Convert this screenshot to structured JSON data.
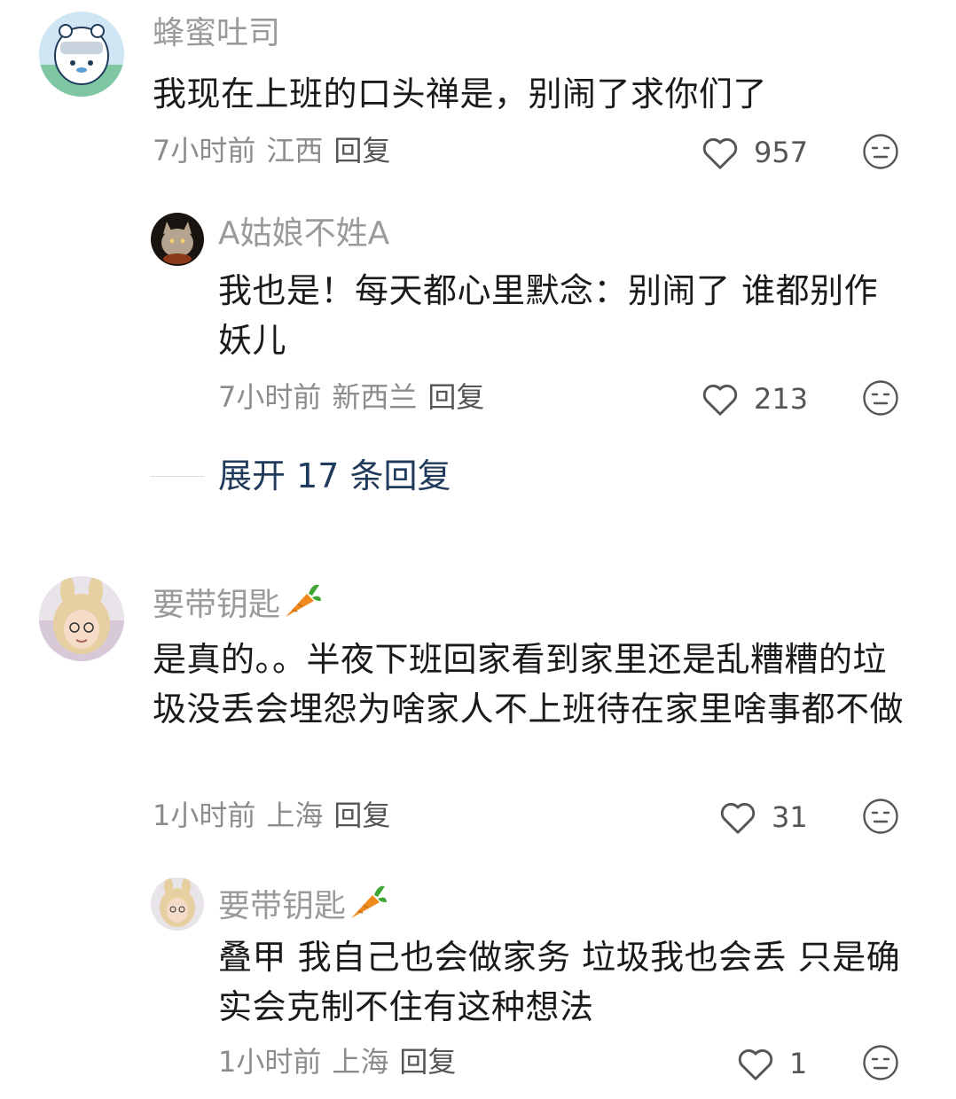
{
  "comments": [
    {
      "username": "蜂蜜吐司",
      "text": "我现在上班的口头禅是，别闹了求你们了",
      "time": "7小时前",
      "location": "江西",
      "reply_label": "回复",
      "likes": "957",
      "replies": [
        {
          "username": "A姑娘不姓A",
          "text": "我也是！每天都心里默念：别闹了 谁都别作妖儿",
          "time": "7小时前",
          "location": "新西兰",
          "reply_label": "回复",
          "likes": "213"
        }
      ],
      "expand_label": "展开 17 条回复"
    },
    {
      "username": "要带钥匙",
      "text": "是真的。。半夜下班回家看到家里还是乱糟糟的垃圾没丢会埋怨为啥家人不上班待在家里啥事都不做",
      "time": "1小时前",
      "location": "上海",
      "reply_label": "回复",
      "likes": "31",
      "replies": [
        {
          "username": "要带钥匙",
          "text": "叠甲 我自己也会做家务 垃圾我也会丢 只是确实会克制不住有这种想法",
          "time": "1小时前",
          "location": "上海",
          "reply_label": "回复",
          "likes": "1"
        }
      ]
    }
  ],
  "icons": {
    "like": "heart-outline-icon",
    "dislike": "neutral-face-icon",
    "name_badge": "carrot-emoji"
  },
  "colors": {
    "username": "#9a9a9a",
    "text": "#1a1a1a",
    "meta": "#8c8c8c",
    "expand": "#1f3a5a"
  }
}
